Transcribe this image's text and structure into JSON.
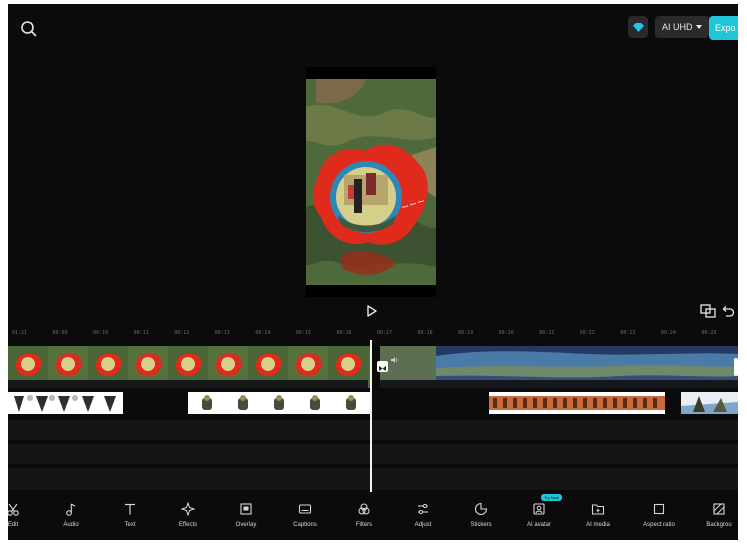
{
  "header": {
    "quality_label": "AI UHD",
    "export_label": "Expo"
  },
  "icons": {
    "search": "search-icon",
    "gem": "gem-icon",
    "play": "play-icon",
    "pip": "picture-in-picture-icon",
    "undo": "undo-icon",
    "transition": "transition-icon",
    "sound": "sound-icon"
  },
  "ruler": {
    "labels": [
      "01:21",
      "00:09",
      "00:10",
      "00:11",
      "00:12",
      "00:13",
      "00:14",
      "00:15",
      "00:16",
      "00:17",
      "00:18",
      "00:19",
      "00:20",
      "00:21",
      "00:22",
      "00:23",
      "00:24",
      "00:25"
    ]
  },
  "toolbar": {
    "items": [
      {
        "label": "Edit",
        "icon": "scissors-icon"
      },
      {
        "label": "Audio",
        "icon": "music-note-icon"
      },
      {
        "label": "Text",
        "icon": "text-icon"
      },
      {
        "label": "Effects",
        "icon": "sparkle-icon"
      },
      {
        "label": "Overlay",
        "icon": "overlay-icon"
      },
      {
        "label": "Captions",
        "icon": "captions-icon"
      },
      {
        "label": "Filters",
        "icon": "filters-icon"
      },
      {
        "label": "Adjust",
        "icon": "adjust-icon"
      },
      {
        "label": "Stickers",
        "icon": "sticker-icon"
      },
      {
        "label": "AI avatar",
        "icon": "ai-avatar-icon"
      },
      {
        "label": "AI media",
        "icon": "ai-media-icon"
      },
      {
        "label": "Aspect ratio",
        "icon": "aspect-ratio-icon"
      },
      {
        "label": "Backgrou",
        "icon": "background-icon"
      }
    ],
    "badge": "Try Now"
  },
  "colors": {
    "accent": "#1ec6d8",
    "background": "#0b0b0c"
  }
}
